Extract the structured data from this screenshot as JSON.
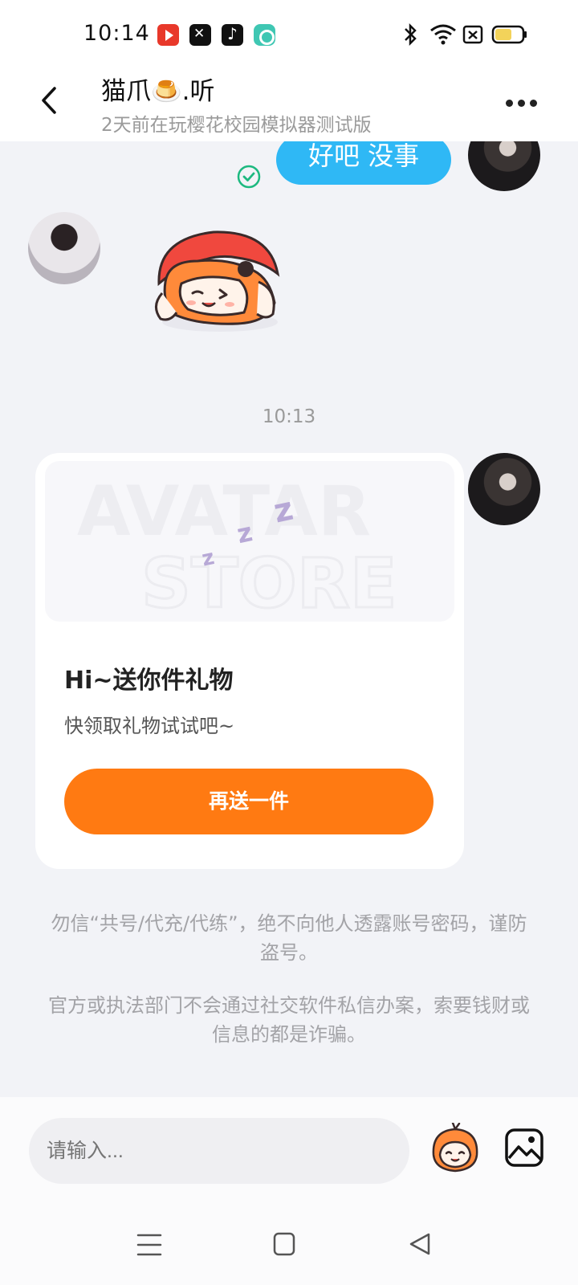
{
  "status_bar": {
    "time": "10:14",
    "app_icons": [
      "youtube-icon",
      "capcut-icon",
      "tiktok-icon",
      "chat-app-icon"
    ],
    "system_icons": [
      "bluetooth-icon",
      "wifi-icon",
      "sim-icon",
      "battery-icon"
    ]
  },
  "header": {
    "title": "猫爪🍮.听",
    "subtitle": "2天前在玩樱花校园模拟器测试版"
  },
  "messages": [
    {
      "type": "text",
      "from": "self",
      "text": "好吧 没事",
      "status": "read"
    },
    {
      "type": "sticker",
      "from": "peer",
      "sticker": "sleepy-character-sticker"
    },
    {
      "type": "time",
      "text": "10:13"
    },
    {
      "type": "gift",
      "from": "self",
      "watermark_line1": "AVATAR",
      "watermark_line2": "STORE",
      "title": "Hi~送你件礼物",
      "subtitle": "快领取礼物试试吧~",
      "button_label": "再送一件"
    }
  ],
  "notices": [
    "勿信“共号/代充/代练”，绝不向他人透露账号密码，谨防盗号。",
    "官方或执法部门不会通过社交软件私信办案，索要钱财或信息的都是诈骗。"
  ],
  "input": {
    "placeholder": "请输入..."
  },
  "colors": {
    "accent": "#ff7a12",
    "bubble": "#2fb8f5",
    "read_check": "#1db980"
  }
}
